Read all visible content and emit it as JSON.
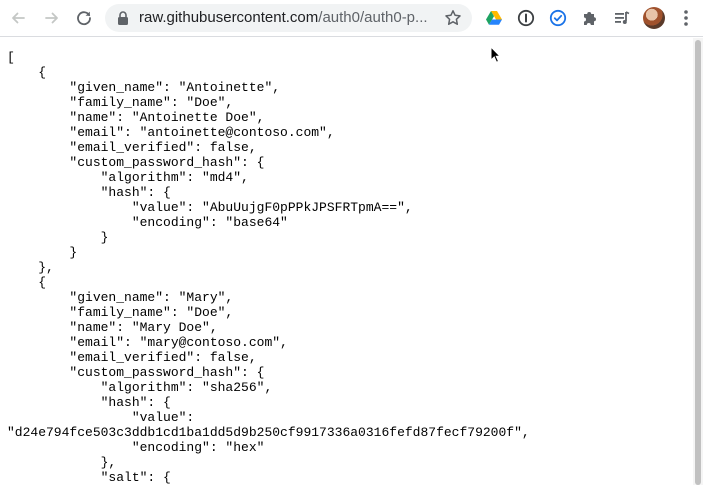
{
  "browser": {
    "url_host": "raw.githubusercontent.com",
    "url_path": "/auth0/auth0-p...",
    "icons": {
      "back": "arrow-left-icon",
      "forward": "arrow-right-icon",
      "reload": "reload-icon",
      "lock": "lock-icon",
      "bookmark": "star-icon",
      "extensions": [
        "google-drive-icon",
        "onepassword-icon",
        "check-circle-icon",
        "puzzle-icon",
        "media-queue-icon"
      ],
      "menu": "vertical-dots-icon"
    }
  },
  "document": {
    "json_text": "[\n    {\n        \"given_name\": \"Antoinette\",\n        \"family_name\": \"Doe\",\n        \"name\": \"Antoinette Doe\",\n        \"email\": \"antoinette@contoso.com\",\n        \"email_verified\": false,\n        \"custom_password_hash\": {\n            \"algorithm\": \"md4\",\n            \"hash\": {\n                \"value\": \"AbuUujgF0pPPkJPSFRTpmA==\",\n                \"encoding\": \"base64\"\n            }\n        }\n    },\n    {\n        \"given_name\": \"Mary\",\n        \"family_name\": \"Doe\",\n        \"name\": \"Mary Doe\",\n        \"email\": \"mary@contoso.com\",\n        \"email_verified\": false,\n        \"custom_password_hash\": {\n            \"algorithm\": \"sha256\",\n            \"hash\": {\n                \"value\":\n\"d24e794fce503c3ddb1cd1ba1dd5d9b250cf9917336a0316fefd87fecf79200f\",\n                \"encoding\": \"hex\"\n            },\n            \"salt\": {"
  },
  "colors": {
    "toolbar_bg": "#ffffff",
    "omnibox_bg": "#f1f3f4",
    "icon_gray": "#5f6368",
    "drive_green": "#1ea362",
    "drive_yellow": "#ffba00",
    "drive_blue": "#2684fc",
    "check_blue": "#1a73e8"
  }
}
